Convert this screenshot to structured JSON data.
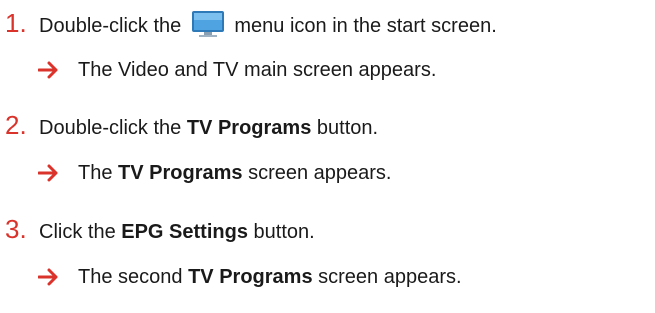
{
  "steps": [
    {
      "number": "1.",
      "text_before": "Double-click the ",
      "icon": "monitor-icon",
      "text_after": " menu icon in the start screen.",
      "result": {
        "text": "The Video and TV main screen appears."
      }
    },
    {
      "number": "2.",
      "text_before": "Double-click the ",
      "bold": "TV Programs",
      "text_after": " button.",
      "result": {
        "before": "The ",
        "bold": "TV Programs",
        "after": " screen appears."
      }
    },
    {
      "number": "3.",
      "text_before": "Click the ",
      "bold": "EPG Settings",
      "text_after": " button.",
      "result": {
        "before": "The second ",
        "bold": "TV Programs",
        "after": " screen appears."
      }
    }
  ],
  "colors": {
    "step_number": "#d9332b",
    "arrow": "#d9332b",
    "text": "#1a1a1a"
  }
}
